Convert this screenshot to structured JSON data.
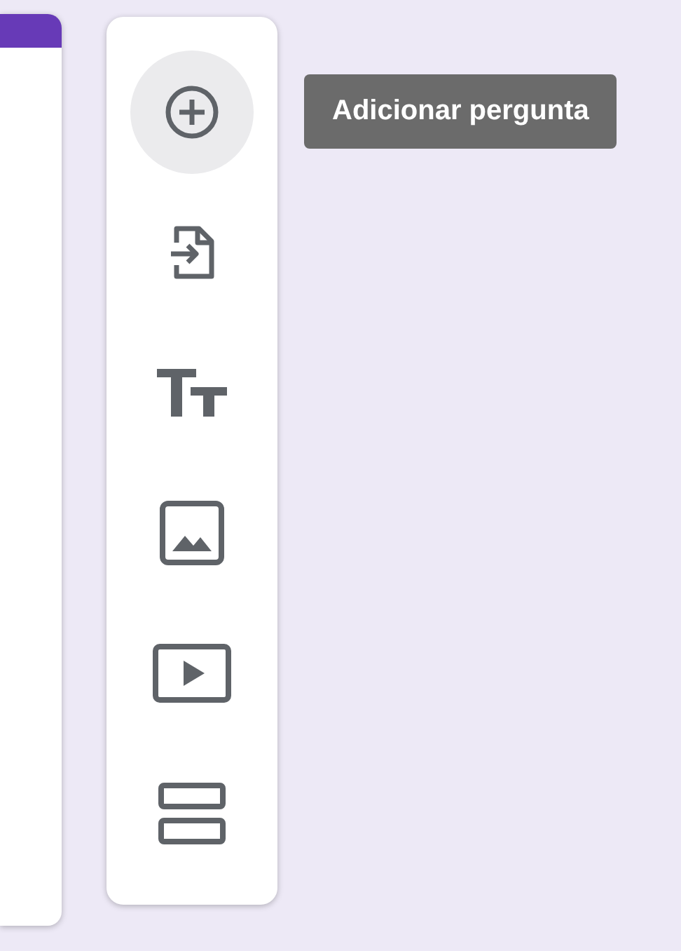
{
  "form_card": {
    "kind": "card"
  },
  "toolbar": {
    "items": [
      {
        "hovered": true
      },
      {
        "hovered": false
      },
      {
        "hovered": false
      },
      {
        "hovered": false
      },
      {
        "hovered": false
      },
      {
        "hovered": false
      }
    ]
  },
  "tooltip": {
    "text": "Adicionar pergunta"
  }
}
